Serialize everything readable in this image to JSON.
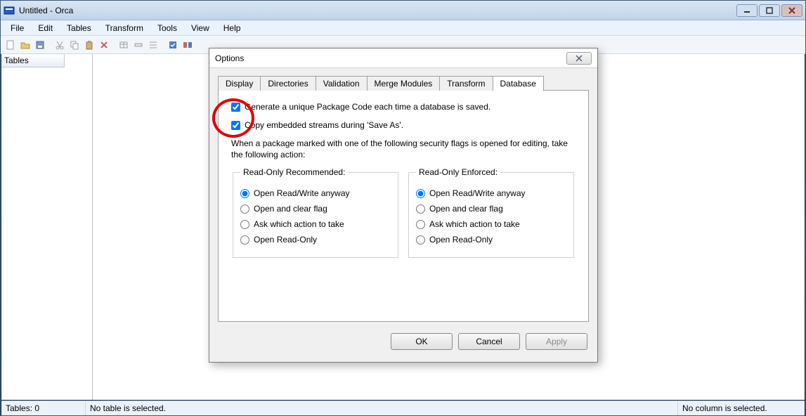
{
  "window": {
    "title": "Untitled - Orca"
  },
  "menubar": [
    "File",
    "Edit",
    "Tables",
    "Transform",
    "Tools",
    "View",
    "Help"
  ],
  "sidebar": {
    "header": "Tables"
  },
  "statusbar": {
    "left": "Tables: 0",
    "mid": "No table is selected.",
    "right": "No column is selected."
  },
  "dialog": {
    "title": "Options",
    "tabs": [
      "Display",
      "Directories",
      "Validation",
      "Merge Modules",
      "Transform",
      "Database"
    ],
    "activeTab": "Database",
    "chk1": {
      "checked": true,
      "label": "Generate a unique Package Code each time a database is saved."
    },
    "chk2": {
      "checked": true,
      "label": "Copy embedded streams during 'Save As'."
    },
    "instr": "When a package marked with one of the following security flags is opened for editing, take the following action:",
    "group1": {
      "legend": "Read-Only Recommended:",
      "selected": 0,
      "options": [
        "Open Read/Write anyway",
        "Open and clear flag",
        "Ask which action to take",
        "Open Read-Only"
      ]
    },
    "group2": {
      "legend": "Read-Only Enforced:",
      "selected": 0,
      "options": [
        "Open Read/Write anyway",
        "Open and clear flag",
        "Ask which action to take",
        "Open Read-Only"
      ]
    },
    "buttons": {
      "ok": "OK",
      "cancel": "Cancel",
      "apply": "Apply"
    }
  }
}
